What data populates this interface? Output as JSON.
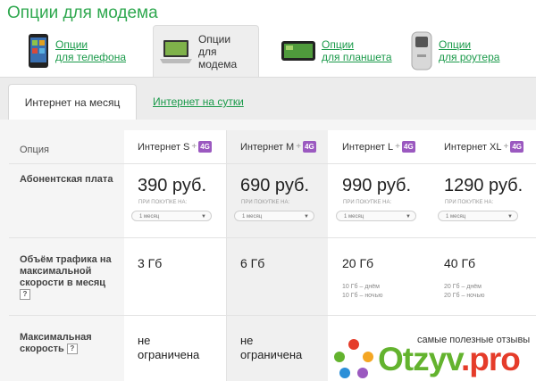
{
  "page": {
    "title": "Опции для модема"
  },
  "device_tabs": [
    {
      "label_line1": "Опции",
      "label_line2": "для телефона",
      "icon": "phone-icon",
      "active": false
    },
    {
      "label_line1": "Опции",
      "label_line2": "для модема",
      "icon": "laptop-icon",
      "active": true
    },
    {
      "label_line1": "Опции",
      "label_line2": "для планшета",
      "icon": "tablet-icon",
      "active": false
    },
    {
      "label_line1": "Опции",
      "label_line2": "для роутера",
      "icon": "router-icon",
      "active": false
    }
  ],
  "period_tabs": {
    "month": "Интернет на месяц",
    "day": "Интернет на сутки"
  },
  "table": {
    "option_header": "Опция",
    "plus": "+",
    "badge": "4G",
    "plans": [
      {
        "name": "Интернет S",
        "price": "390 руб.",
        "traffic": "3 Гб",
        "speed_line1": "не",
        "speed_line2": "ограничена"
      },
      {
        "name": "Интернет M",
        "price": "690 руб.",
        "traffic": "6 Гб",
        "speed_line1": "не",
        "speed_line2": "ограничена"
      },
      {
        "name": "Интернет L",
        "price": "990 руб.",
        "traffic": "20 Гб",
        "traffic_day": "10 Гб – днём",
        "traffic_night": "10 Гб – ночью"
      },
      {
        "name": "Интернет XL",
        "price": "1290 руб.",
        "traffic": "40 Гб",
        "traffic_day": "20 Гб – днём",
        "traffic_night": "20 Гб – ночью"
      }
    ],
    "buy_note": "ПРИ ПОКУПКЕ НА:",
    "select_value": "1 месяц",
    "row_fee": "Абонентская плата",
    "row_traffic_line1": "Объём трафика на",
    "row_traffic_line2": "максимальной",
    "row_traffic_line3": "скорости в месяц",
    "row_speed_line1": "Максимальная",
    "row_speed_line2": "скорость",
    "help_mark": "?"
  },
  "watermark": {
    "tagline": "самые полезные отзывы",
    "brand": "Otzyv",
    "brand_suffix": ".pro"
  },
  "colors": {
    "green": "#2fa84f",
    "link": "#1a9a4a",
    "badge": "#9b59c0",
    "brand_green": "#63b32e",
    "brand_red": "#e53c2a"
  }
}
